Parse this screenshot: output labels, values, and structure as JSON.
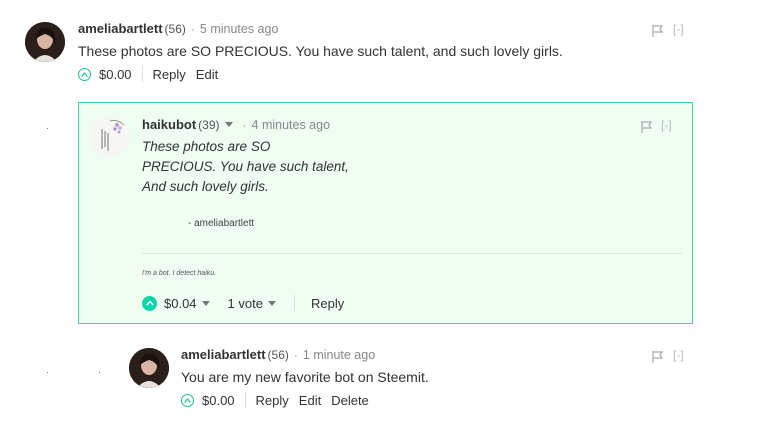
{
  "comments": [
    {
      "author": "ameliabartlett",
      "reputation": "(56)",
      "time": "5 minutes ago",
      "body": "These photos are SO PRECIOUS. You have such talent, and such lovely girls.",
      "payout": "$0.00",
      "actions": [
        "Reply",
        "Edit"
      ],
      "collapse": "[-]"
    },
    {
      "author": "haikubot",
      "reputation": "(39)",
      "time": "4 minutes ago",
      "poem": [
        "These photos are SO",
        "PRECIOUS. You have such talent,",
        "And such lovely girls."
      ],
      "signature": "- ameliabartlett",
      "note": "I'm a bot. I detect haiku.",
      "payout": "$0.04",
      "votes": "1 vote",
      "actions": [
        "Reply"
      ],
      "collapse": "[-]"
    },
    {
      "author": "ameliabartlett",
      "reputation": "(56)",
      "time": "1 minute ago",
      "body": "You are my new favorite bot on Steemit.",
      "payout": "$0.00",
      "actions": [
        "Reply",
        "Edit",
        "Delete"
      ],
      "collapse": "[-]"
    }
  ],
  "separator": "·",
  "colors": {
    "accent": "#06d6a9",
    "highlight_bg": "#effdf3",
    "highlight_border": "#4bcfa8"
  }
}
